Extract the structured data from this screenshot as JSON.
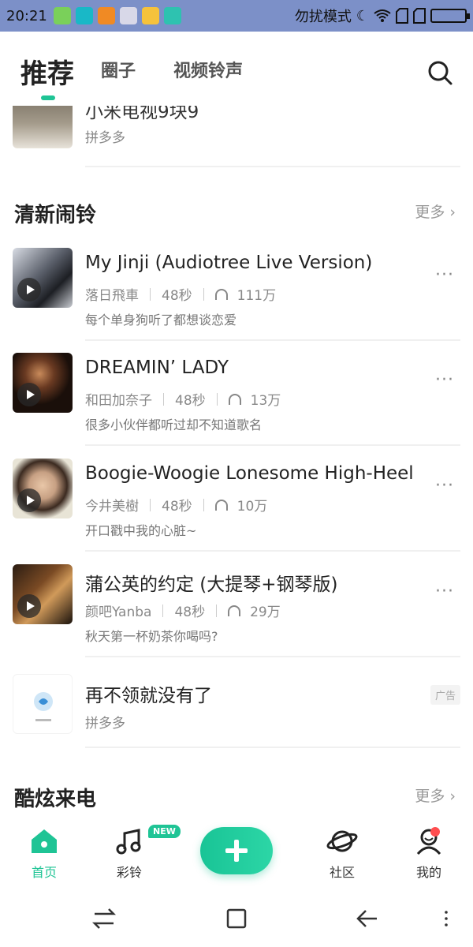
{
  "status_bar": {
    "time": "20:21",
    "dnd": "勿扰模式"
  },
  "top_tabs": [
    {
      "label": "推荐",
      "active": true
    },
    {
      "label": "圈子",
      "active": false
    },
    {
      "label": "视频铃声",
      "active": false
    }
  ],
  "partial_item": {
    "title": "小米电视9块9",
    "source": "拼多多"
  },
  "section1": {
    "title": "清新闹铃",
    "more": "更多 ›"
  },
  "songs": [
    {
      "title": "My Jinji (Audiotree Live Version)",
      "artist": "落日飛車",
      "duration": "48秒",
      "plays": "111万",
      "desc": "每个单身狗听了都想谈恋爱"
    },
    {
      "title": "DREAMIN’ LADY",
      "artist": "和田加奈子",
      "duration": "48秒",
      "plays": "13万",
      "desc": "很多小伙伴都听过却不知道歌名"
    },
    {
      "title": "Boogie-Woogie Lonesome High-Heel",
      "artist": "今井美樹",
      "duration": "48秒",
      "plays": "10万",
      "desc": "开口戳中我的心脏~"
    },
    {
      "title": "蒲公英的约定 (大提琴+钢琴版)",
      "artist": "颜吧Yanba",
      "duration": "48秒",
      "plays": "29万",
      "desc": "秋天第一杯奶茶你喝吗?"
    }
  ],
  "ad_item": {
    "title": "再不领就没有了",
    "source": "拼多多",
    "tag": "广告"
  },
  "section2": {
    "title": "酷炫来电",
    "more": "更多 ›"
  },
  "bottom_nav": {
    "home": "首页",
    "ringtone": "彩铃",
    "new_badge": "NEW",
    "community": "社区",
    "mine": "我的"
  },
  "colors": {
    "accent": "#1fc495",
    "statusbar": "#7c90c8"
  }
}
